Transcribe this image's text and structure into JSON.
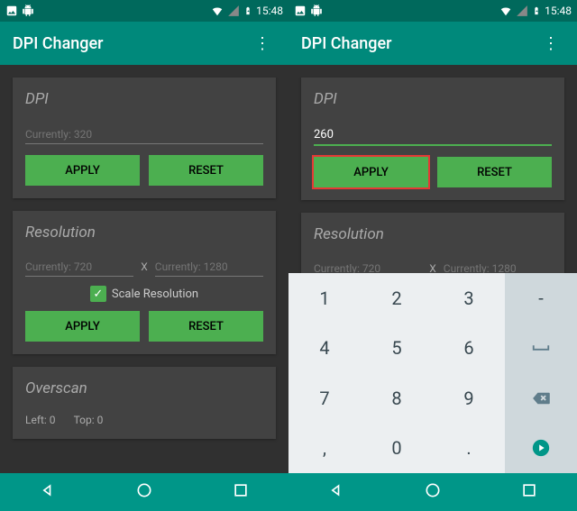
{
  "status": {
    "time": "15:48"
  },
  "app": {
    "title": "DPI Changer"
  },
  "dpi": {
    "title": "DPI",
    "placeholder_left": "Currently: 320",
    "value_right": "260",
    "apply": "APPLY",
    "reset": "RESET"
  },
  "resolution": {
    "title": "Resolution",
    "width_placeholder": "Currently: 720",
    "height_placeholder": "Currently: 1280",
    "separator": "X",
    "scale_label": "Scale Resolution",
    "apply": "APPLY",
    "reset": "RESET"
  },
  "overscan": {
    "title": "Overscan",
    "left_label": "Left: 0",
    "top_label": "Top: 0"
  },
  "keyboard": {
    "keys": [
      "1",
      "2",
      "3",
      "4",
      "5",
      "6",
      "7",
      "8",
      "9",
      "0"
    ],
    "dash": "-",
    "comma": ",",
    "dot": "."
  }
}
